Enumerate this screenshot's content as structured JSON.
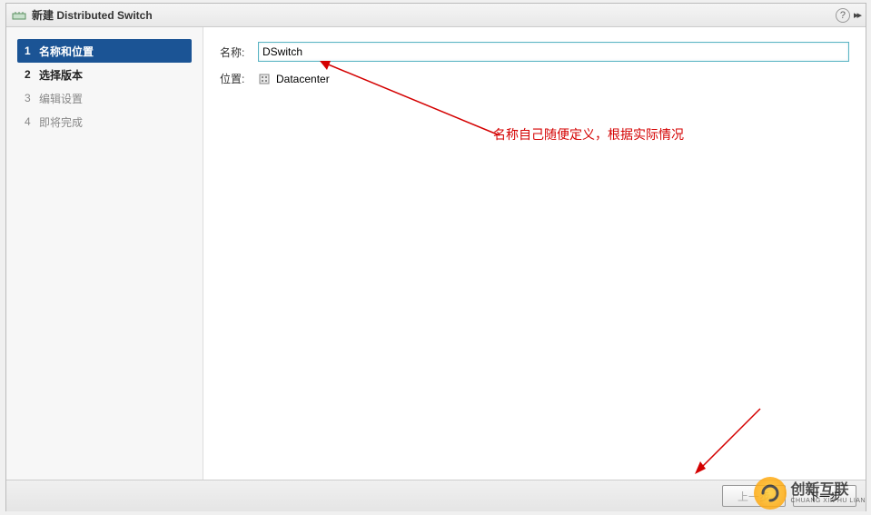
{
  "title": "新建 Distributed Switch",
  "sidebar": {
    "steps": [
      {
        "num": "1",
        "label": "名称和位置"
      },
      {
        "num": "2",
        "label": "选择版本"
      },
      {
        "num": "3",
        "label": "编辑设置"
      },
      {
        "num": "4",
        "label": "即将完成"
      }
    ]
  },
  "form": {
    "name_label": "名称:",
    "name_value": "DSwitch",
    "location_label": "位置:",
    "location_value": "Datacenter"
  },
  "annotation": {
    "text": "名称自己随便定义，根据实际情况"
  },
  "footer": {
    "back": "上一步",
    "next": "下一步"
  },
  "watermark": {
    "main": "创新互联",
    "sub": "CHUANG XIN HU LIAN"
  }
}
